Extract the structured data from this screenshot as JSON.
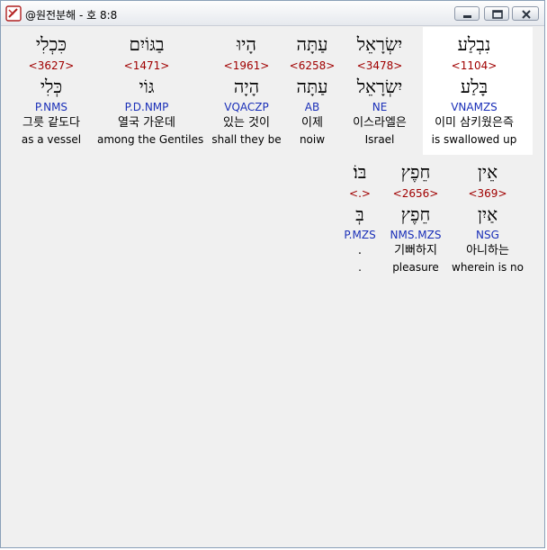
{
  "window": {
    "title": "@원전분해 - 호 8:8"
  },
  "verse_lines": [
    {
      "words": [
        {
          "hebrew": "נִבְלַע",
          "strong": "<1104>",
          "lemma": "בָּלַע",
          "morph": "VNAMZS",
          "korean": "이미 삼키웠은즉",
          "english": "is swallowed up"
        },
        {
          "hebrew": "יִשְׂרָאֵל",
          "strong": "<3478>",
          "lemma": "יִשְׂרָאֵל",
          "morph": "NE",
          "korean": "이스라엘은",
          "english": "Israel"
        },
        {
          "hebrew": "עַתָּה",
          "strong": "<6258>",
          "lemma": "עַתָּה",
          "morph": "AB",
          "korean": "이제",
          "english": "noiw"
        },
        {
          "hebrew": "הָיוּ",
          "strong": "<1961>",
          "lemma": "הָיָה",
          "morph": "VQACZP",
          "korean": "있는 것이",
          "english": "shall they be"
        },
        {
          "hebrew": "בַגּוֹיִם",
          "strong": "<1471>",
          "lemma": "גּוֹי",
          "morph": "P.D.NMP",
          "korean": "열국 가운데",
          "english": "among the Gentiles"
        },
        {
          "hebrew": "כִּכְלִי",
          "strong": "<3627>",
          "lemma": "כְּלִי",
          "morph": "P.NMS",
          "korean": "그릇 같도다",
          "english": "as a vessel"
        }
      ]
    },
    {
      "words": [
        {
          "hebrew": "אֵין",
          "strong": "<369>",
          "lemma": "אַיִן",
          "morph": "NSG",
          "korean": "아니하는",
          "english": "wherein is no"
        },
        {
          "hebrew": "חֵפֶץ",
          "strong": "<2656>",
          "lemma": "חֵפֶץ",
          "morph": "NMS.MZS",
          "korean": "기뻐하지",
          "english": "pleasure"
        },
        {
          "hebrew": "בּוֹ׃",
          "strong": "<.>",
          "lemma": "בְּ",
          "morph": "P.MZS",
          "korean": ".",
          "english": "."
        }
      ]
    }
  ]
}
